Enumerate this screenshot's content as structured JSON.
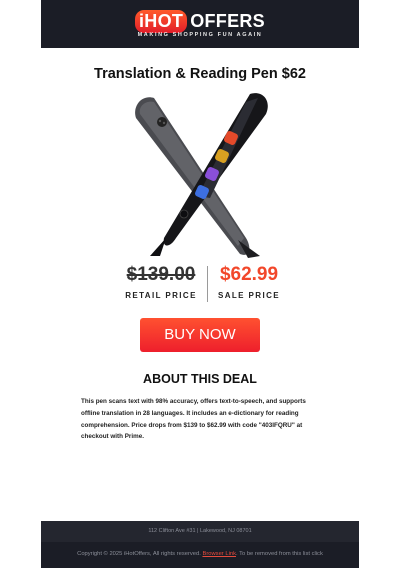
{
  "brand": {
    "logo_hot": "iHOT",
    "logo_offers": "OFFERS",
    "tagline": "MAKING SHOPPING FUN AGAIN",
    "accent_color": "#ee1f2c",
    "header_bg": "#1b1d26"
  },
  "deal": {
    "title": "Translation & Reading Pen $62",
    "image_icon": "translation-pen-product-image",
    "retail_price": "$139.00",
    "retail_label": "RETAIL PRICE",
    "sale_price": "$62.99",
    "sale_label": "SALE PRICE",
    "sale_color": "#f2472a",
    "buy_label": "BUY NOW",
    "about_heading": "ABOUT THIS DEAL",
    "description": "This pen scans text with 98% accuracy, offers text-to-speech, and supports offline translation in 28 languages. It includes an e-dictionary for reading comprehension. Price drops from $139 to $62.99 with code \"403IFQRU\" at checkout with Prime."
  },
  "footer": {
    "address": "112 Clifton Ave #31 | Lakewood, NJ 08701",
    "copyright_prefix": "Copyright © 2025 iHotOffers, All rights reserved.",
    "browser_link": "Browser Link",
    "copyright_suffix": ". To be removed from this list click"
  }
}
